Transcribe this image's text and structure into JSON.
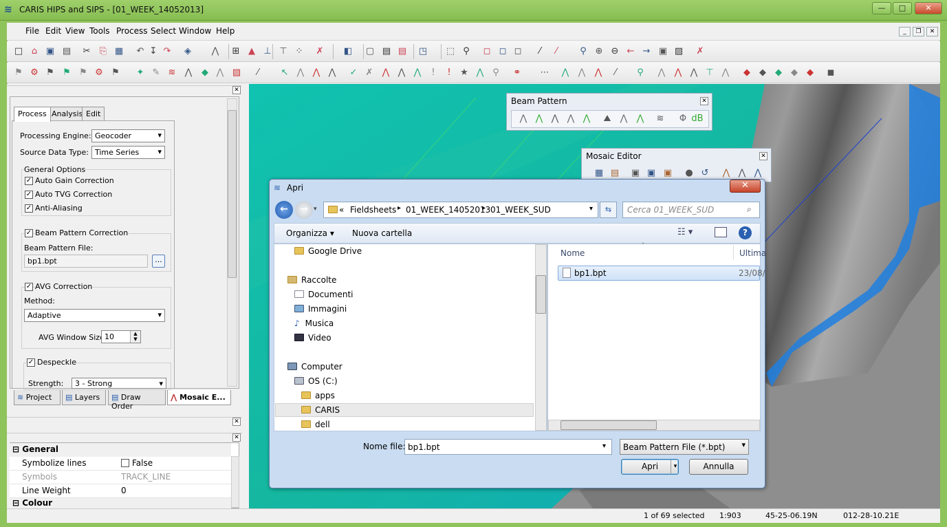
{
  "window": {
    "title": "CARIS HIPS and SIPS - [01_WEEK_14052013]"
  },
  "menu": [
    "File",
    "Edit",
    "View",
    "Tools",
    "Process",
    "Select",
    "Window",
    "Help"
  ],
  "process_panel": {
    "tabs": [
      "Process",
      "Analysis",
      "Edit"
    ],
    "engine_label": "Processing Engine:",
    "engine_value": "Geocoder",
    "source_label": "Source Data Type:",
    "source_value": "Time Series",
    "general_options": "General Options",
    "auto_gain": "Auto Gain Correction",
    "auto_tvg": "Auto TVG Correction",
    "anti_aliasing": "Anti-Aliasing",
    "beam_pattern": "Beam Pattern Correction",
    "beam_file_label": "Beam Pattern File:",
    "beam_file_value": "bp1.bpt",
    "browse": "...",
    "avg": "AVG Correction",
    "method_label": "Method:",
    "method_value": "Adaptive",
    "avg_window_label": "AVG Window Size:",
    "avg_window_value": "10",
    "despeckle": "Despeckle",
    "strength_label": "Strength:",
    "strength_value": "3 - Strong"
  },
  "bottom_tabs": [
    "Project",
    "Layers",
    "Draw Order",
    "Mosaic E..."
  ],
  "properties": {
    "section_general": "General",
    "rows": [
      {
        "name": "Symbolize lines",
        "value": "False"
      },
      {
        "name": "Symbols",
        "value": "TRACK_LINE"
      },
      {
        "name": "Line Weight",
        "value": "0"
      }
    ],
    "section_colour": "Colour"
  },
  "floating": {
    "beam_pattern": "Beam Pattern",
    "mosaic_editor": "Mosaic Editor",
    "db_label": "+dB"
  },
  "dialog": {
    "title": "Apri",
    "breadcrumb": [
      "«",
      "Fieldsheets",
      "01_WEEK_14052013",
      "01_WEEK_SUD"
    ],
    "search_placeholder": "Cerca 01_WEEK_SUD",
    "organize": "Organizza",
    "new_folder": "Nuova cartella",
    "nav": {
      "google_drive": "Google Drive",
      "raccolte": "Raccolte",
      "documenti": "Documenti",
      "immagini": "Immagini",
      "musica": "Musica",
      "video": "Video",
      "computer": "Computer",
      "os": "OS (C:)",
      "apps": "apps",
      "caris": "CARIS",
      "dell": "dell"
    },
    "col_name": "Nome",
    "col_modified": "Ultima",
    "file_name": "bp1.bpt",
    "file_date": "23/08/",
    "filename_label": "Nome file:",
    "filename_value": "bp1.bpt",
    "filter": "Beam Pattern File (*.bpt)",
    "open": "Apri",
    "cancel": "Annulla"
  },
  "status": {
    "selected": "1 of 69 selected",
    "scale": "1:903",
    "lat": "45-25-06.19N",
    "lon": "012-28-10.21E"
  },
  "colors": {
    "title_green": "#8fc35b",
    "map_teal": "#16b6a0",
    "swath_blue": "#1e7fe0"
  }
}
